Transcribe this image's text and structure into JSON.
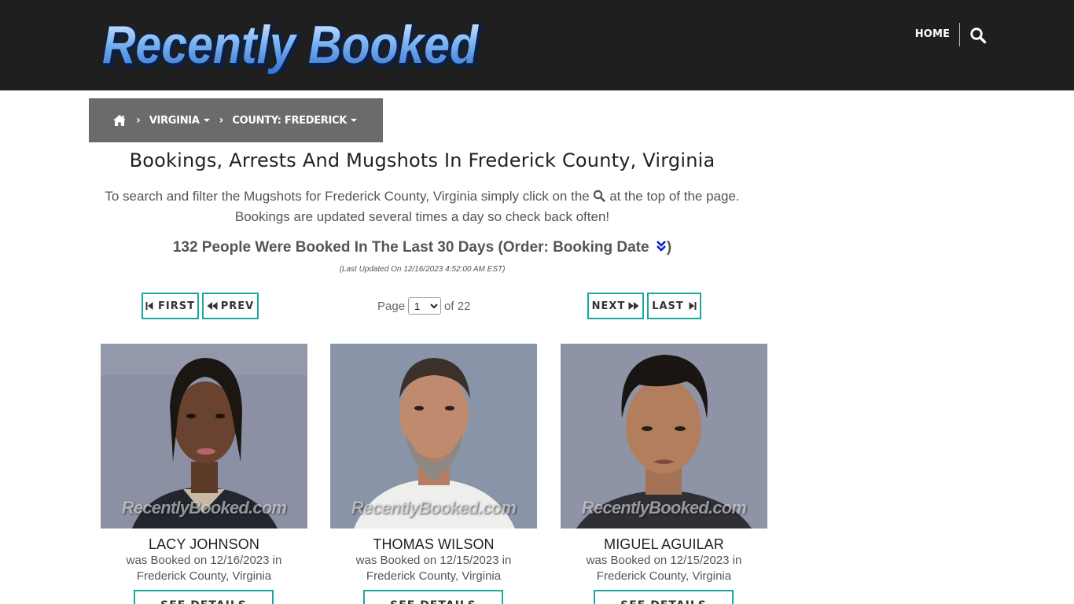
{
  "header": {
    "logo_text": "Recently Booked",
    "nav_home": "HOME",
    "search_icon": "search-icon"
  },
  "breadcrumb": {
    "home_icon": "home-icon",
    "separator": "›",
    "items": [
      {
        "label": "VIRGINIA"
      },
      {
        "label": "COUNTY: FREDERICK"
      }
    ]
  },
  "main": {
    "title": "Bookings, Arrests And Mugshots In Frederick County, Virginia",
    "intro_before": "To search and filter the Mugshots for Frederick County, Virginia simply click on the",
    "intro_after": "at the top of the page.",
    "intro_line2": "Bookings are updated several times a day so check back often!",
    "count_text": "132 People Were Booked In The Last 30 Days (Order: Booking Date",
    "count_close": ")",
    "last_updated": "(Last Updated On 12/16/2023 4:52:00 AM EST)"
  },
  "pager": {
    "first": "FIRST",
    "prev": "PREV",
    "next": "NEXT",
    "last": "LAST",
    "page_label": "Page",
    "current_page": "1",
    "of_label": "of 22"
  },
  "cards": [
    {
      "name": "LACY JOHNSON",
      "booked_line": "was Booked on 12/16/2023 in",
      "location": "Frederick County, Virginia",
      "watermark": "RecentlyBooked.com",
      "button": "SEE DETAILS"
    },
    {
      "name": "THOMAS WILSON",
      "booked_line": "was Booked on 12/15/2023 in",
      "location": "Frederick County, Virginia",
      "watermark": "RecentlyBooked.com",
      "button": "SEE DETAILS"
    },
    {
      "name": "MIGUEL AGUILAR",
      "booked_line": "was Booked on 12/15/2023 in",
      "location": "Frederick County, Virginia",
      "watermark": "RecentlyBooked.com",
      "button": "SEE DETAILS"
    }
  ],
  "colors": {
    "header_bg": "#1f1f1f",
    "breadcrumb_bg": "#6b6b6b",
    "button_border": "#1aa89e",
    "logo_blue": "#5aa0ee",
    "order_icon": "#0a1fd1"
  }
}
